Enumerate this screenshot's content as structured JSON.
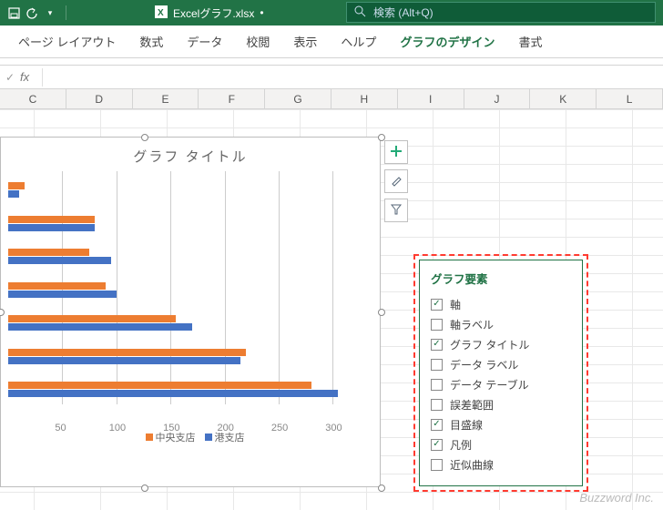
{
  "titlebar": {
    "filename": "Excelグラフ.xlsx",
    "modified": "•",
    "search_placeholder": "検索 (Alt+Q)"
  },
  "ribbon": {
    "tabs": [
      "ページ レイアウト",
      "数式",
      "データ",
      "校閲",
      "表示",
      "ヘルプ",
      "グラフのデザイン",
      "書式"
    ],
    "active_idx": 6
  },
  "columns": [
    "C",
    "D",
    "E",
    "F",
    "G",
    "H",
    "I",
    "J",
    "K",
    "L"
  ],
  "chart_data": {
    "type": "bar",
    "title": "グラフ タイトル",
    "series": [
      {
        "name": "中央支店",
        "color": "#ed7d31",
        "values": [
          15,
          80,
          75,
          90,
          155,
          220,
          280
        ]
      },
      {
        "name": "港支店",
        "color": "#4472c4",
        "values": [
          10,
          80,
          95,
          100,
          170,
          215,
          305
        ]
      }
    ],
    "xticks": [
      50,
      100,
      150,
      200,
      250,
      300
    ],
    "xmax": 320
  },
  "sidebuttons": [
    {
      "name": "chart-elements",
      "icon": "plus"
    },
    {
      "name": "chart-styles",
      "icon": "brush"
    },
    {
      "name": "chart-filters",
      "icon": "funnel"
    }
  ],
  "flyout": {
    "title": "グラフ要素",
    "items": [
      {
        "label": "軸",
        "checked": true
      },
      {
        "label": "軸ラベル",
        "checked": false
      },
      {
        "label": "グラフ タイトル",
        "checked": true
      },
      {
        "label": "データ ラベル",
        "checked": false
      },
      {
        "label": "データ テーブル",
        "checked": false
      },
      {
        "label": "誤差範囲",
        "checked": false
      },
      {
        "label": "目盛線",
        "checked": true
      },
      {
        "label": "凡例",
        "checked": true
      },
      {
        "label": "近似曲線",
        "checked": false
      }
    ]
  },
  "watermark": "Buzzword Inc."
}
